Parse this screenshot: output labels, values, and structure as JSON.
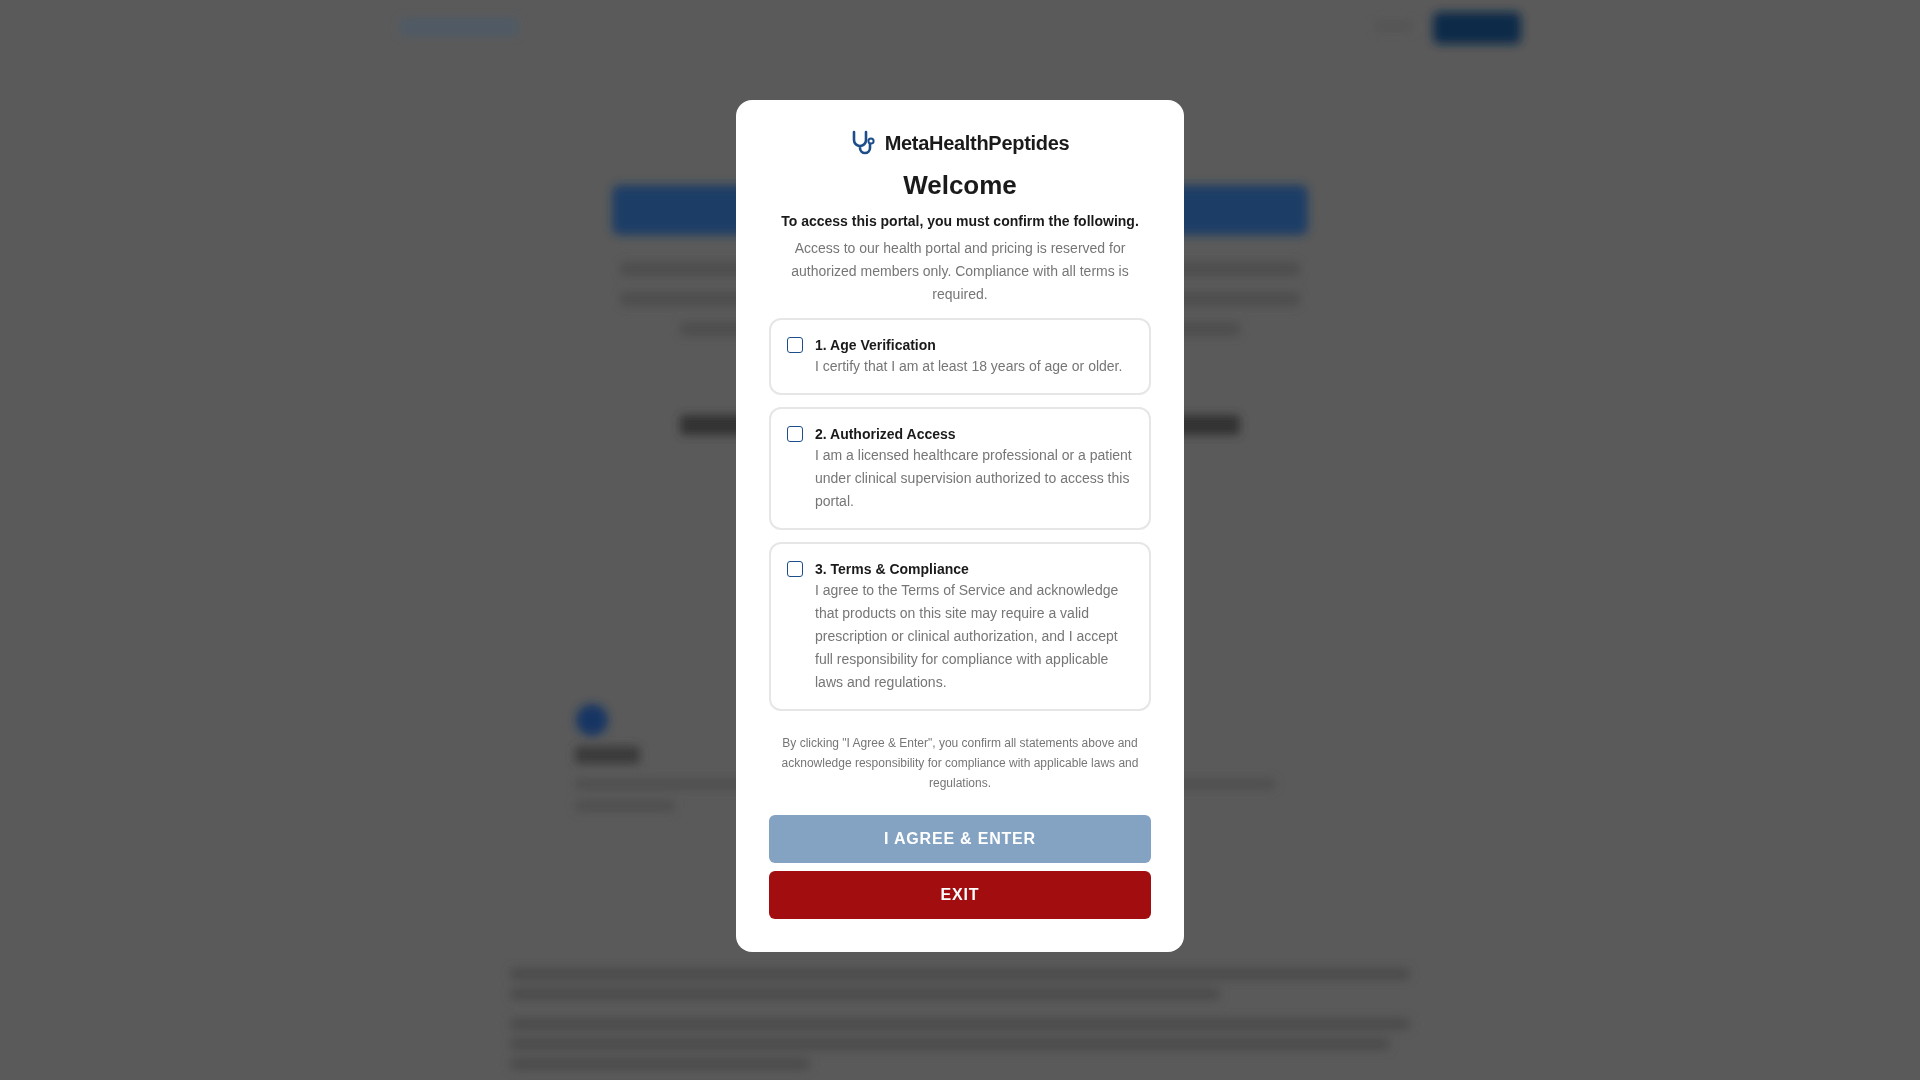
{
  "dialog": {
    "brand": "MetaHealthPeptides",
    "title": "Welcome",
    "subtitle": "To access this portal, you must confirm the following.",
    "intro": "Access to our health portal and pricing is reserved for authorized members only. Compliance with all terms is required.",
    "confirmations": [
      {
        "heading": "1. Age Verification",
        "text": "I certify that I am at least 18 years of age or older.",
        "checked": false
      },
      {
        "heading": "2. Authorized Access",
        "text": "I am a licensed healthcare professional or a patient under clinical supervision authorized to access this portal.",
        "checked": false
      },
      {
        "heading": "3. Terms & Compliance",
        "text": "I agree to the Terms of Service and acknowledge that products on this site may require a valid prescription or clinical authorization, and I accept full responsibility for compliance with applicable laws and regulations.",
        "checked": false
      }
    ],
    "notice": "By clicking \"I Agree & Enter\", you confirm all statements above and acknowledge responsibility for compliance with applicable laws and regulations.",
    "buttons": [
      {
        "label": "I AGREE & ENTER",
        "kind": "primary",
        "disabled": true
      },
      {
        "label": "EXIT",
        "kind": "danger",
        "disabled": false
      }
    ]
  }
}
